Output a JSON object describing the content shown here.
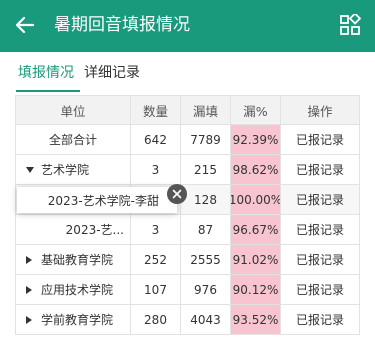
{
  "header": {
    "title": "暑期回音填报情况",
    "back_icon": "arrow-left-icon",
    "menu_icon": "grid-icon"
  },
  "tabs": [
    {
      "label": "填报情况",
      "active": true
    },
    {
      "label": "详细记录",
      "active": false
    }
  ],
  "table": {
    "columns": [
      "单位",
      "数量",
      "漏填",
      "漏%",
      "操作"
    ],
    "rows": [
      {
        "unit": "全部合计",
        "count": "642",
        "missing": "7789",
        "pct": "92.39%",
        "action": "已报记录",
        "expand": "none"
      },
      {
        "unit": "艺术学院",
        "count": "3",
        "missing": "215",
        "pct": "98.62%",
        "action": "已报记录",
        "expand": "expanded"
      },
      {
        "unit": "2023-艺术学院-李甜",
        "count": "",
        "missing": "128",
        "pct": "100.00%",
        "action": "已报记录",
        "expand": "none"
      },
      {
        "unit": "2023-艺...",
        "count": "3",
        "missing": "87",
        "pct": "96.67%",
        "action": "已报记录",
        "expand": "none"
      },
      {
        "unit": "基础教育学院",
        "count": "252",
        "missing": "2555",
        "pct": "91.02%",
        "action": "已报记录",
        "expand": "collapsed"
      },
      {
        "unit": "应用技术学院",
        "count": "107",
        "missing": "976",
        "pct": "90.12%",
        "action": "已报记录",
        "expand": "collapsed"
      },
      {
        "unit": "学前教育学院",
        "count": "280",
        "missing": "4043",
        "pct": "93.52%",
        "action": "已报记录",
        "expand": "collapsed"
      }
    ]
  },
  "tooltip": {
    "text": "2023-艺术学院-李甜"
  },
  "colors": {
    "primary": "#1a9a7c",
    "highlight": "#f7c4cf"
  }
}
